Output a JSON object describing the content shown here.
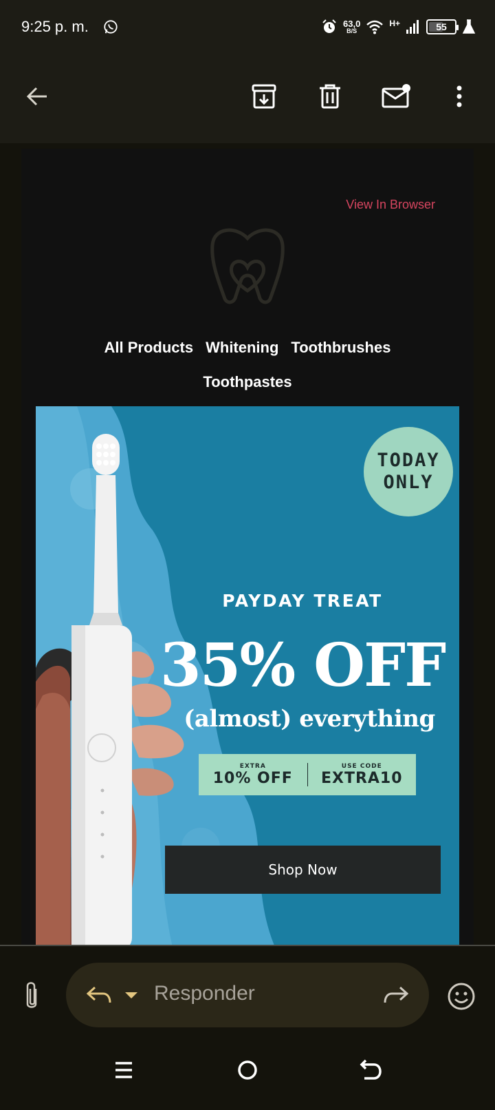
{
  "status_bar": {
    "time": "9:25 p. m.",
    "speed_value": "63,0",
    "speed_unit": "B/S",
    "network": "H+",
    "battery": "55",
    "battery_level": 0.55,
    "icons": [
      "whatsapp-icon",
      "alarm-icon",
      "wifi-icon",
      "signal-icon",
      "battery-icon",
      "flask-icon"
    ]
  },
  "toolbar": {
    "icons": [
      "back-arrow-icon",
      "archive-icon",
      "delete-icon",
      "mark-unread-icon",
      "more-vert-icon"
    ]
  },
  "email": {
    "view_in_browser": "View In Browser",
    "nav": [
      "All Products",
      "Whitening",
      "Toothbrushes",
      "Toothpastes"
    ],
    "banner": {
      "badge_line1": "TODAY",
      "badge_line2": "ONLY",
      "headline": "PAYDAY TREAT",
      "discount": "35% OFF",
      "subhead": "(almost) everything",
      "extra_label": "EXTRA",
      "extra_value": "10% OFF",
      "code_label": "USE CODE",
      "code_value": "EXTRA10",
      "cta": "Shop Now"
    },
    "colors": {
      "banner_bg": "#1a7ea2",
      "accent_mint": "#9fd6c0",
      "link": "#d6455f"
    }
  },
  "reply_bar": {
    "placeholder": "Responder",
    "icons": [
      "attach-icon",
      "reply-icon",
      "dropdown-caret-icon",
      "forward-icon",
      "emoji-icon"
    ]
  },
  "nav_bar": {
    "icons": [
      "recents-icon",
      "home-icon",
      "back-icon"
    ]
  }
}
